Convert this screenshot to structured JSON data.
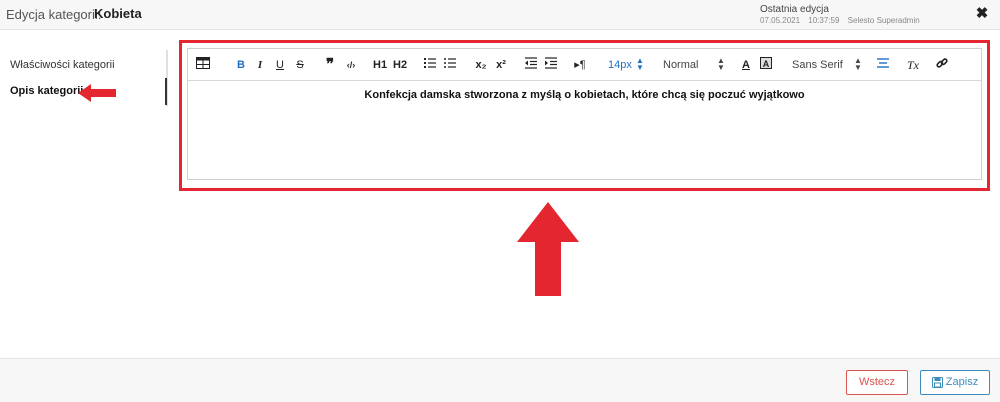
{
  "header": {
    "label": "Edycja kategorii:",
    "value": "Kobieta",
    "last_edit": {
      "title": "Ostatnia edycja",
      "date": "07.05.2021",
      "time": "10:37:59",
      "user": "Selesto Superadmin"
    },
    "close_icon": "close-icon"
  },
  "sidebar": {
    "items": [
      {
        "label": "Właściwości kategorii",
        "active": false
      },
      {
        "label": "Opis kategorii",
        "active": true
      }
    ]
  },
  "editor": {
    "toolbar": {
      "bold": "B",
      "italic": "I",
      "underline": "U",
      "strike": "S",
      "h1": "H1",
      "h2": "H2",
      "subscript": "x₂",
      "superscript": "x²",
      "font_size": "14px",
      "heading_select": "Normal",
      "font_family": "Sans Serif",
      "clear_format": "Tx"
    },
    "content": "Konfekcja damska stworzona z myślą o kobietach, które chcą się poczuć wyjątkowo"
  },
  "footer": {
    "back_label": "Wstecz",
    "save_label": "Zapisz"
  },
  "colors": {
    "annotation_red": "#e3262f",
    "link_blue": "#1f6fc5",
    "back_red": "#d9534f",
    "save_blue": "#3c8dbc"
  }
}
